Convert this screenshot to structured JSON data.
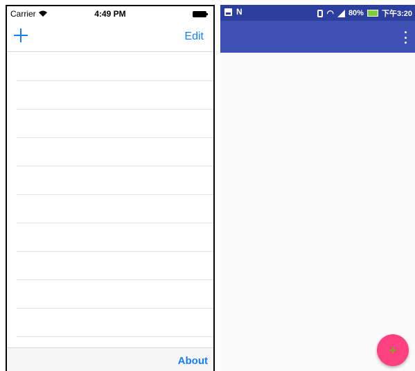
{
  "ios": {
    "status": {
      "carrier": "Carrier",
      "time": "4:49 PM"
    },
    "nav": {
      "edit_label": "Edit"
    },
    "list": {
      "row_count": 10
    },
    "toolbar": {
      "about_label": "About"
    }
  },
  "android": {
    "status": {
      "battery_percent": "80%",
      "time": "下午3:20"
    },
    "colors": {
      "app_bar": "#3f51b5",
      "fab": "#ff4081"
    }
  }
}
